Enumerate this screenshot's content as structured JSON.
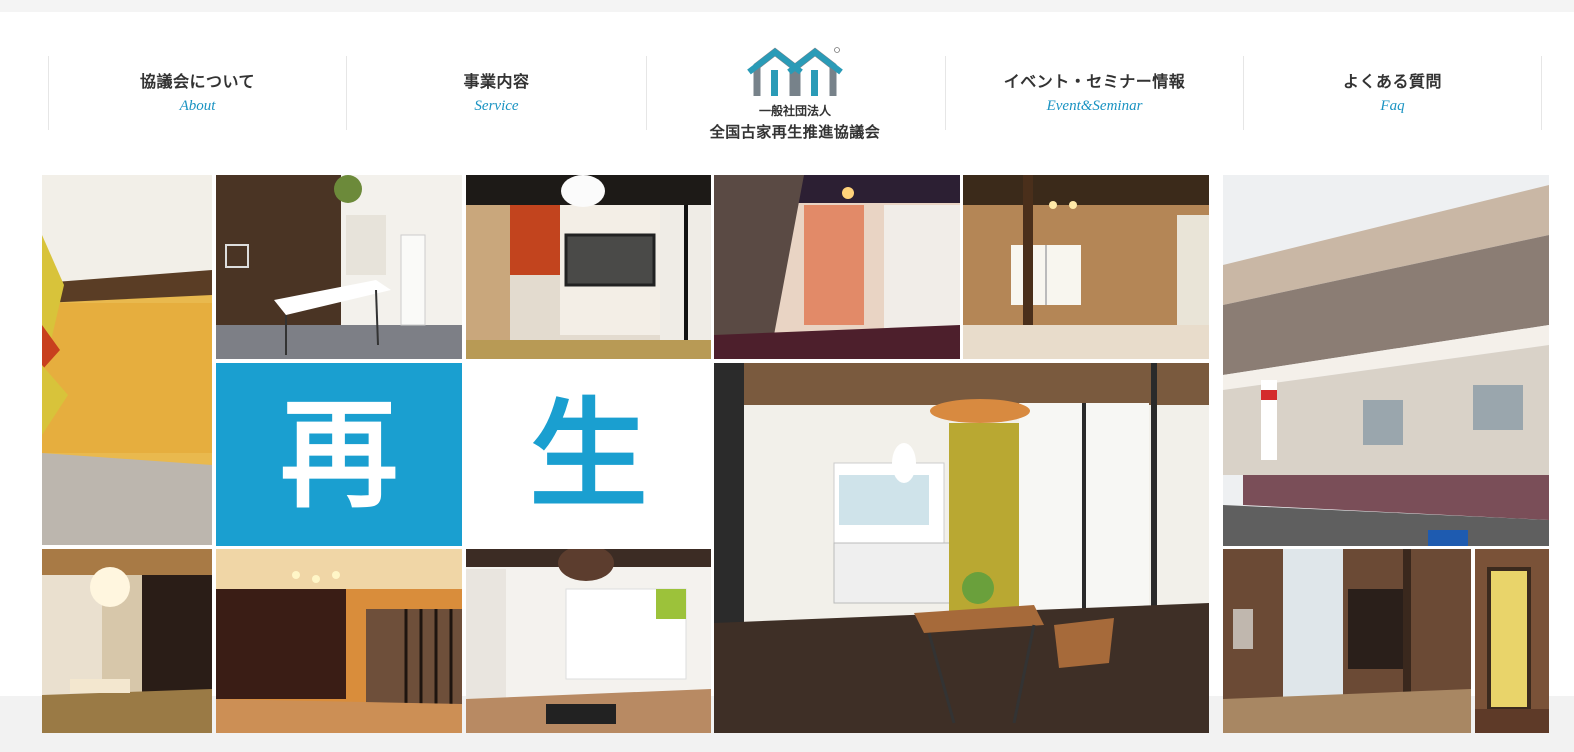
{
  "nav": {
    "items": [
      {
        "ja": "協議会について",
        "en": "About"
      },
      {
        "ja": "事業内容",
        "en": "Service"
      },
      {
        "ja": "イベント・セミナー情報",
        "en": "Event&Seminar"
      },
      {
        "ja": "よくある質問",
        "en": "Faq"
      }
    ]
  },
  "logo": {
    "subtitle": "一般社団法人",
    "name": "全国古家再生推進協議会"
  },
  "hero": {
    "kanji_left": "再",
    "kanji_right": "生"
  },
  "colors": {
    "accent": "#1a93c2",
    "kanji_tile_bg": "#1a9fd0",
    "logo_teal": "#2a9bb7",
    "logo_gray": "#77828a"
  }
}
